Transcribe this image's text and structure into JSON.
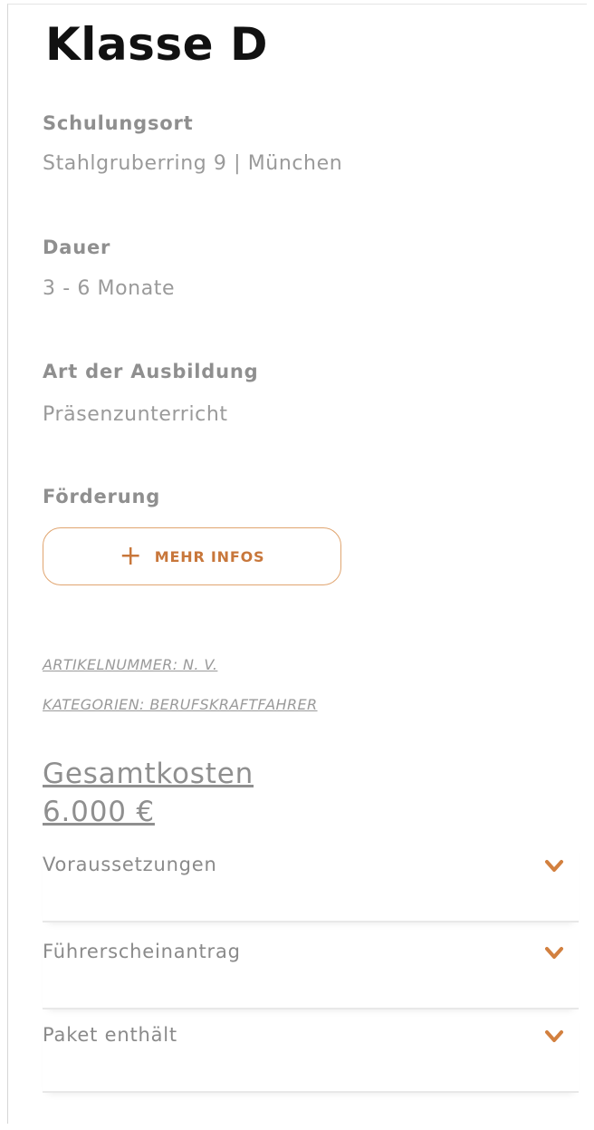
{
  "title": "Klasse D",
  "details": [
    {
      "label": "Schulungsort",
      "value": "Stahlgruberring 9 | München"
    },
    {
      "label": "Dauer",
      "value": "3 - 6 Monate"
    },
    {
      "label": "Art der Ausbildung",
      "value": "Präsenzunterricht"
    }
  ],
  "foerderung": {
    "label": "Förderung",
    "button_icon": "+",
    "button_label": "MEHR INFOS"
  },
  "meta": {
    "artikelnummer": "ARTIKELNUMMER: N. V.",
    "kategorien": "KATEGORIEN: BERUFSKRAFTFAHRER"
  },
  "price": {
    "label": "Gesamtkosten",
    "value": "6.000 €"
  },
  "accordion": [
    {
      "label": "Voraussetzungen"
    },
    {
      "label": "Führerscheinantrag"
    },
    {
      "label": "Paket enthält"
    }
  ],
  "colors": {
    "accent": "#c8773b",
    "button_border": "#e0a570",
    "text_gray": "#8f8f8f",
    "title": "#111111"
  },
  "icons": {
    "accordion_toggle": "chevron-down-icon",
    "button": "plus-icon"
  }
}
